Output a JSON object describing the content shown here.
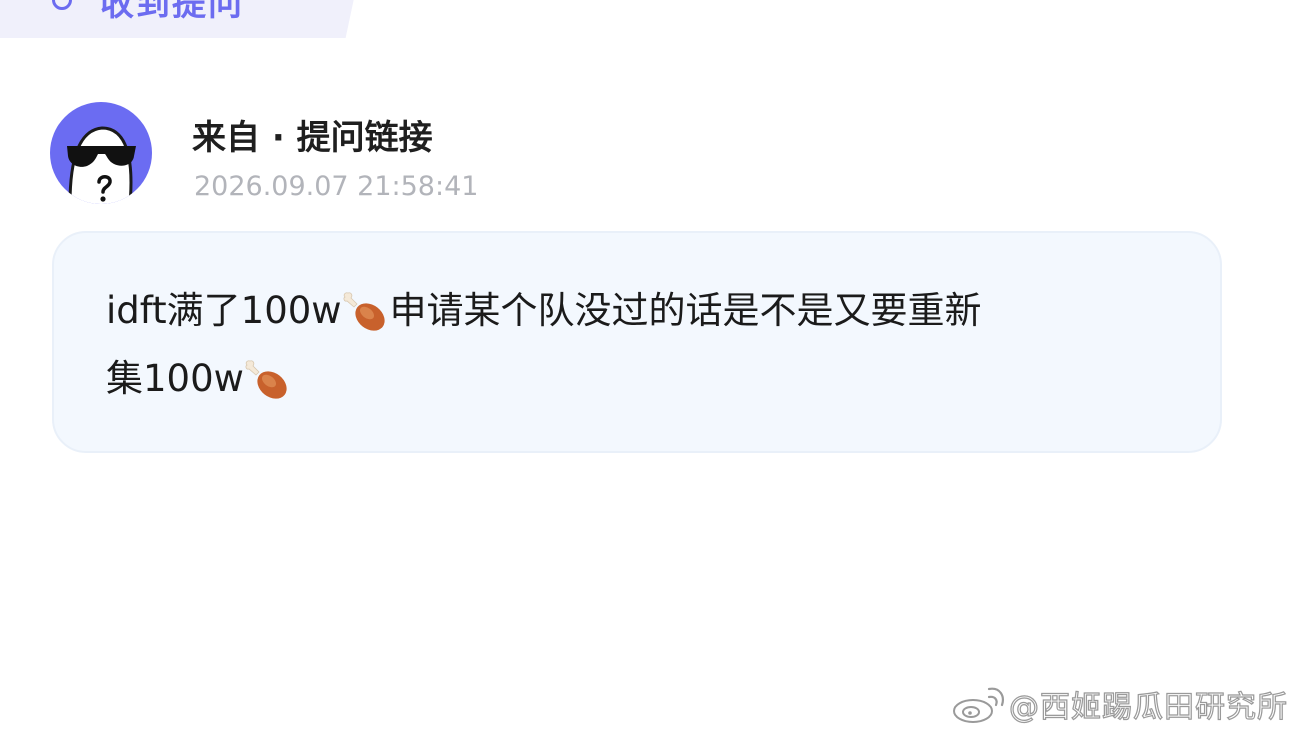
{
  "header": {
    "tab_title": "收到提问"
  },
  "sender": {
    "name": "来自 · 提问链接",
    "timestamp": "2026.09.07 21:58:41"
  },
  "message": {
    "line1_a": "idft满了100w",
    "line1_b": "申请某个队没过的话是不是又要重新",
    "line2_a": "集100w",
    "emoji": "drumstick"
  },
  "watermark": {
    "text": "@西姬踢瓜田研究所"
  },
  "colors": {
    "accent": "#6b6cf2",
    "bubble_bg": "#f3f8fe",
    "timestamp": "#b2b4ba"
  }
}
